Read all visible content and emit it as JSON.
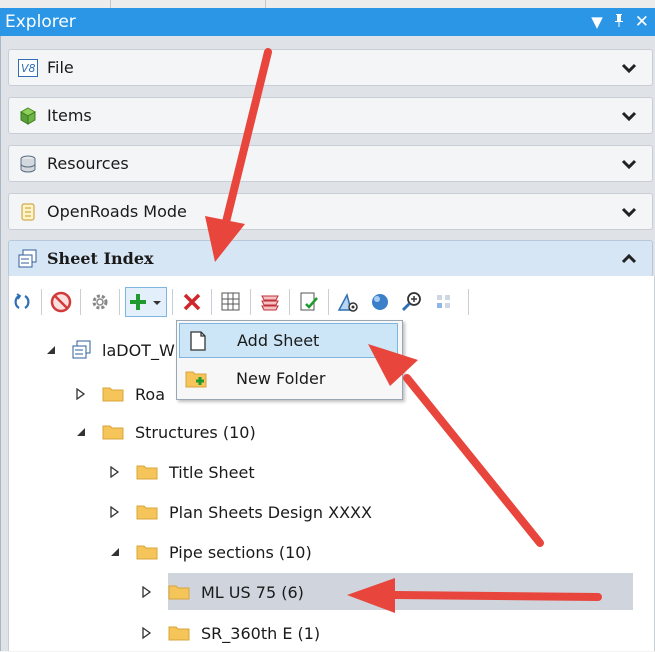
{
  "window": {
    "title": "Explorer",
    "controls": {
      "dropdown": "▾",
      "pin": "ᵖ",
      "close": "✕"
    }
  },
  "sections": [
    {
      "label": "File",
      "icon": "v8-file-icon"
    },
    {
      "label": "Items",
      "icon": "items-icon"
    },
    {
      "label": "Resources",
      "icon": "resources-icon"
    },
    {
      "label": "OpenRoads Mode",
      "icon": "openroads-icon"
    },
    {
      "label": "Sheet Index",
      "icon": "sheet-index-icon",
      "expanded": true
    }
  ],
  "toolbar": {
    "buttons": [
      "refresh",
      "delete-red-circle",
      "settings",
      "add",
      "delete",
      "table",
      "layers",
      "check-sheet",
      "properties",
      "sphere",
      "zoom",
      "grid"
    ]
  },
  "context_menu": {
    "items": [
      {
        "label": "Add Sheet",
        "highlighted": true
      },
      {
        "label": "New Folder",
        "highlighted": false
      }
    ]
  },
  "tree": {
    "root": "laDOT_W",
    "roadway": "Roa",
    "structures": "Structures (10)",
    "title_sheet": "Title Sheet",
    "plan_sheets": "Plan Sheets Design XXXX",
    "pipe_sections": "Pipe sections (10)",
    "ml_us75": "ML US 75 (6)",
    "sr_360": "SR_360th E (1)"
  },
  "colors": {
    "titlebar": "#2b96e6",
    "panel": "#dfe3e8",
    "arrow": "#e8453c",
    "folder": "#f5c55a",
    "selection": "#cfd4dd",
    "menu_highlight": "#cde6f7"
  }
}
